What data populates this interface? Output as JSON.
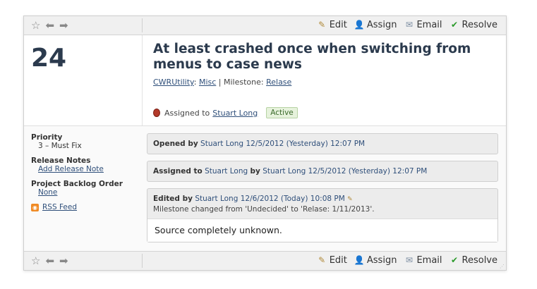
{
  "toolbar": {
    "edit_label": "Edit",
    "assign_label": "Assign",
    "email_label": "Email",
    "resolve_label": "Resolve"
  },
  "case": {
    "number": "24",
    "title": "At least crashed once when switching from menus to case news",
    "project": "CWRUtility",
    "area": "Misc",
    "milestone_label": "Milestone:",
    "milestone": "Relase",
    "assigned_to_label": "Assigned to",
    "assigned_to": "Stuart Long",
    "status": "Active"
  },
  "sidebar": {
    "priority_label": "Priority",
    "priority_value": "3 – Must Fix",
    "release_notes_label": "Release Notes",
    "release_notes_link": "Add Release Note",
    "backlog_label": "Project Backlog Order",
    "backlog_value": "None",
    "rss_label": "RSS Feed"
  },
  "events": [
    {
      "action": "Opened by",
      "person": "Stuart Long",
      "date": "12/5/2012 (Yesterday) 12:07 PM"
    },
    {
      "action": "Assigned to",
      "target": "Stuart Long",
      "by_label": "by",
      "person": "Stuart Long",
      "date": "12/5/2012 (Yesterday) 12:07 PM"
    },
    {
      "action": "Edited by",
      "person": "Stuart Long",
      "date": "12/6/2012 (Today) 10:08 PM",
      "change": "Milestone changed from 'Undecided' to 'Relase: 1/11/2013'.",
      "body": "Source completely unknown."
    }
  ],
  "icons": {
    "star": "star-icon",
    "back": "arrow-left-icon",
    "forward": "arrow-right-icon",
    "edit": "edit-icon",
    "assign": "assign-user-icon",
    "email": "email-icon",
    "resolve": "checkmark-icon",
    "bug": "bug-icon",
    "rss": "rss-icon"
  }
}
